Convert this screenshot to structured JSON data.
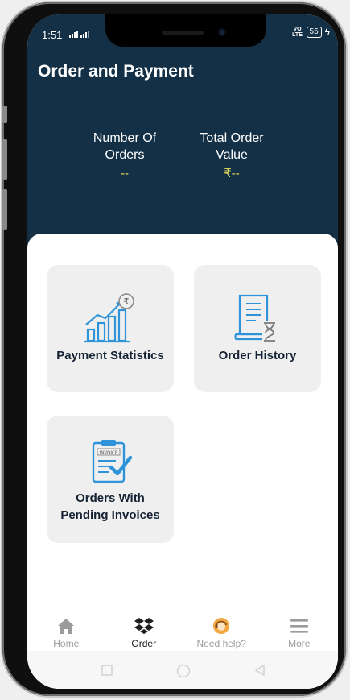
{
  "status": {
    "time": "1:51",
    "network": "VO LTE",
    "battery": "55"
  },
  "header": {
    "title": "Order and Payment"
  },
  "stats": [
    {
      "label_line1": "Number Of",
      "label_line2": "Orders",
      "value": "--"
    },
    {
      "label_line1": "Total Order",
      "label_line2": "Value",
      "value": "₹--"
    }
  ],
  "cards": {
    "payment_statistics": "Payment Statistics",
    "order_history": "Order History",
    "pending_line1": "Orders With",
    "pending_line2": "Pending Invoices",
    "invoice_tag": "INVOICE"
  },
  "nav": [
    {
      "label": "Home",
      "icon": "home-icon"
    },
    {
      "label": "Order",
      "icon": "dropbox-icon",
      "active": true
    },
    {
      "label": "Need help?",
      "icon": "support-agent-icon"
    },
    {
      "label": "More",
      "icon": "menu-icon"
    }
  ],
  "colors": {
    "header": "#133046",
    "accent": "#2e93d8",
    "value": "#e7e05f",
    "card": "#efefef"
  }
}
